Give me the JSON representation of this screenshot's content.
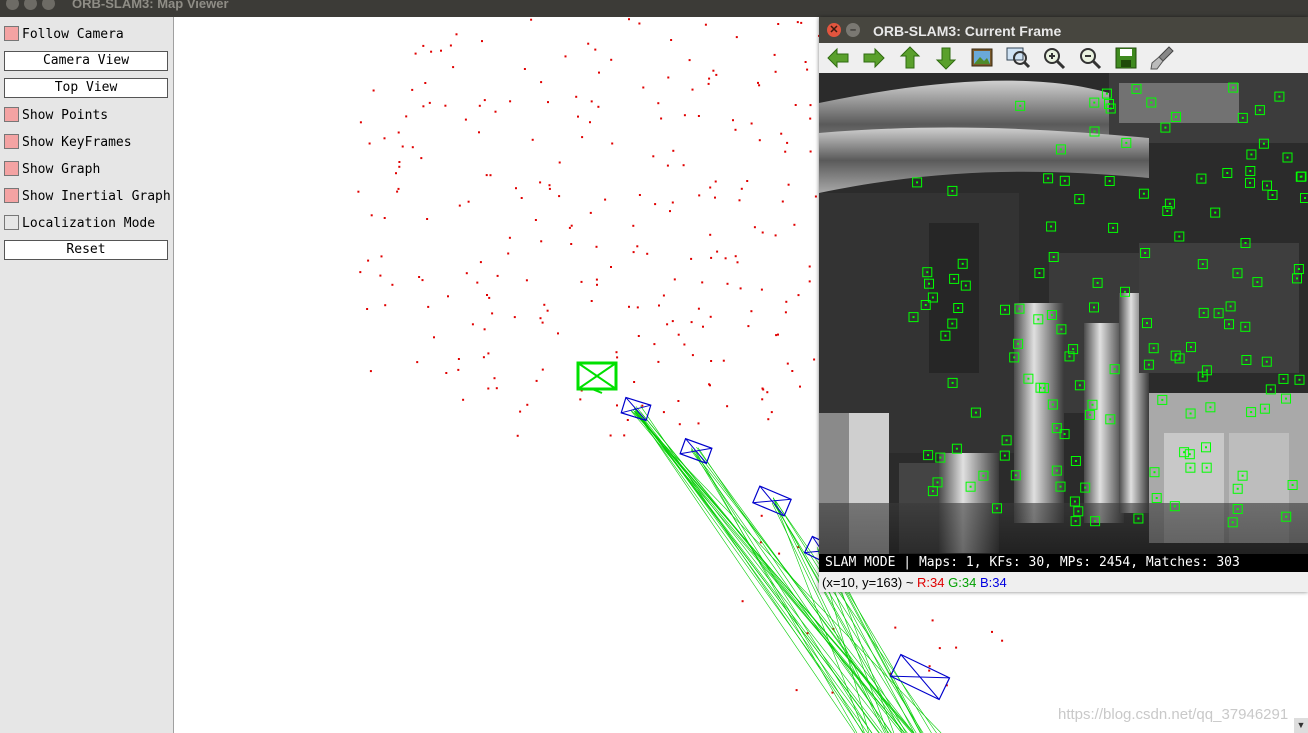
{
  "map_viewer": {
    "title": "ORB-SLAM3: Map Viewer",
    "panel": {
      "follow_camera": "Follow Camera",
      "camera_view": "Camera View",
      "top_view": "Top View",
      "show_points": "Show Points",
      "show_keyframes": "Show KeyFrames",
      "show_graph": "Show Graph",
      "show_inertial_graph": "Show Inertial Graph",
      "localization_mode": "Localization Mode",
      "reset": "Reset"
    },
    "checkbox_states": {
      "follow_camera": true,
      "show_points": true,
      "show_keyframes": true,
      "show_graph": true,
      "show_inertial_graph": true,
      "localization_mode": false
    },
    "colors": {
      "map_points": "#e00000",
      "current_camera": "#00e000",
      "keyframes": "#0000cc",
      "covisibility_graph": "#00cc00"
    }
  },
  "current_frame": {
    "title": "ORB-SLAM3: Current Frame",
    "toolbar_icons": [
      "arrow-left-icon",
      "arrow-right-icon",
      "arrow-up-icon",
      "arrow-down-icon",
      "image-icon",
      "zoom-fit-icon",
      "zoom-in-icon",
      "zoom-out-icon",
      "save-icon",
      "brush-icon"
    ],
    "status": {
      "mode": "SLAM MODE",
      "stats": "Maps: 1, KFs: 30, MPs: 2454, Matches: 303"
    },
    "coords": {
      "cursor": "(x=10, y=163) ~",
      "r": "R:34",
      "g": "G:34",
      "b": "B:34"
    },
    "colors": {
      "feature_boxes": "#00ff00"
    }
  },
  "watermark": "https://blog.csdn.net/qq_37946291"
}
